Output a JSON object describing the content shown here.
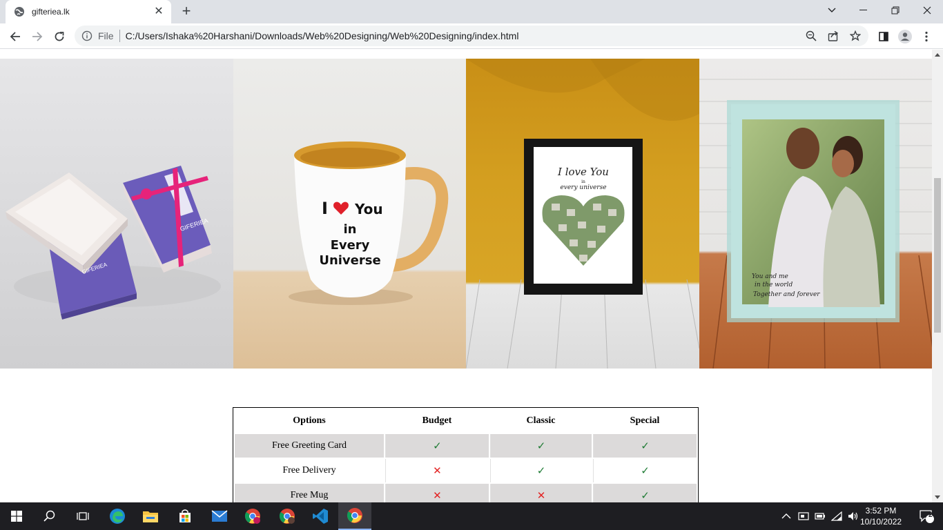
{
  "browser": {
    "tab_title": "gifteriea.lk",
    "url_scheme": "File",
    "url": "C:/Users/Ishaka%20Harshani/Downloads/Web%20Designing/Web%20Designing/index.html"
  },
  "gallery": {
    "items": [
      {
        "name": "gift-box",
        "brand": "GIFERIEA"
      },
      {
        "name": "mug",
        "text_lines": [
          "I",
          "You",
          "in",
          "Every",
          "Universe"
        ]
      },
      {
        "name": "heart-collage-frame",
        "text_lines": [
          "I love You",
          "in",
          "every universe"
        ]
      },
      {
        "name": "glass-photo-frame",
        "text_lines": [
          "You and me",
          "in the world",
          "Together and forever"
        ]
      }
    ]
  },
  "table": {
    "headers": [
      "Options",
      "Budget",
      "Classic",
      "Special"
    ],
    "rows": [
      {
        "label": "Free Greeting Card",
        "values": [
          true,
          true,
          true
        ]
      },
      {
        "label": "Free Delivery",
        "values": [
          false,
          true,
          true
        ]
      },
      {
        "label": "Free Mug",
        "values": [
          false,
          false,
          true
        ]
      }
    ],
    "colors": {
      "check": "#1e7b34",
      "cross": "#e32424",
      "shade": "#dcdada"
    }
  },
  "taskbar": {
    "time": "3:52 PM",
    "date": "10/10/2022",
    "notifications": "2"
  }
}
